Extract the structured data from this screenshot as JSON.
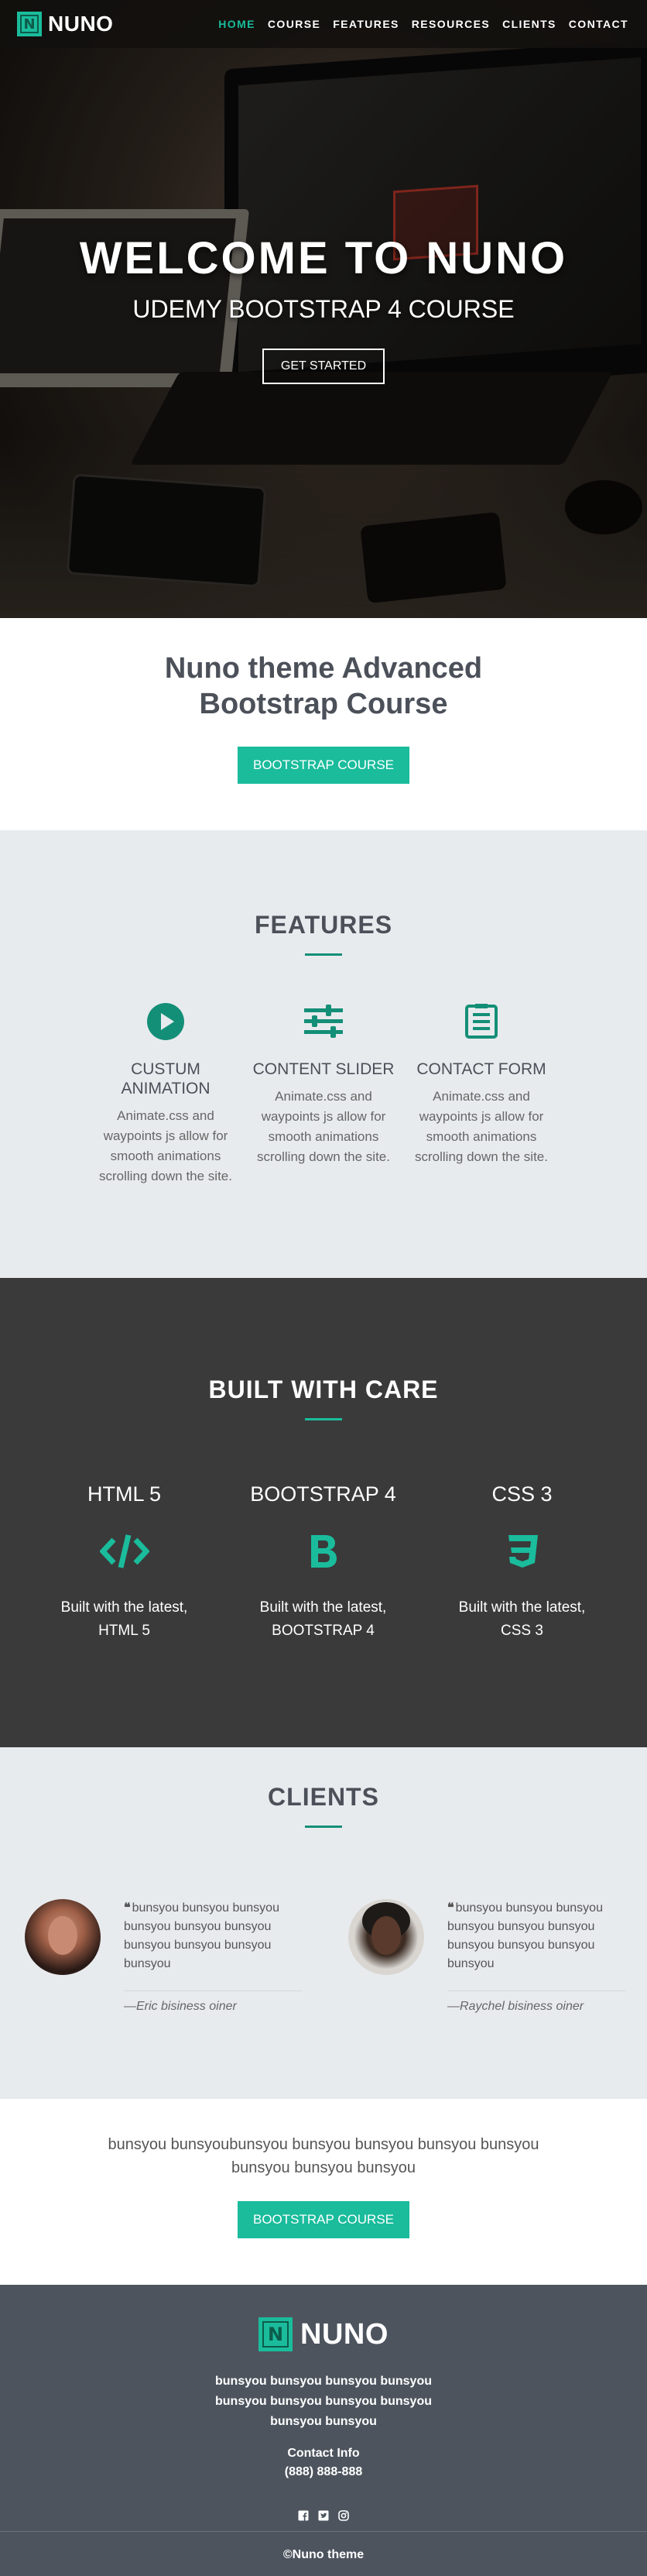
{
  "brand": {
    "name": "NUNO",
    "mark": "N"
  },
  "nav": {
    "items": [
      {
        "label": "HOME",
        "active": true
      },
      {
        "label": "COURSE"
      },
      {
        "label": "FEATURES"
      },
      {
        "label": "RESOURCES"
      },
      {
        "label": "CLIENTS"
      },
      {
        "label": "CONTACT"
      }
    ]
  },
  "hero": {
    "title": "WELCOME TO NUNO",
    "subtitle": "UDEMY BOOTSTRAP 4 COURSE",
    "button": "GET STARTED"
  },
  "intro": {
    "title": "Nuno theme Advanced Bootstrap Course",
    "button": "BOOTSTRAP COURSE"
  },
  "features": {
    "title": "FEATURES",
    "items": [
      {
        "icon": "play-circle-icon",
        "title": "CUSTUM ANIMATION",
        "text": "Animate.css and waypoints js allow for smooth animations scrolling down the site."
      },
      {
        "icon": "sliders-icon",
        "title": "CONTENT SLIDER",
        "text": "Animate.css and waypoints js allow for smooth animations scrolling down the site."
      },
      {
        "icon": "form-icon",
        "title": "CONTACT FORM",
        "text": "Animate.css and waypoints js allow for smooth animations scrolling down the site."
      }
    ]
  },
  "built": {
    "title": "BUILT WITH CARE",
    "items": [
      {
        "title": "HTML 5",
        "icon": "code-icon",
        "text": "Built with the latest, HTML 5"
      },
      {
        "title": "BOOTSTRAP 4",
        "icon": "bootstrap-icon",
        "text": "Built with the latest, BOOTSTRAP 4"
      },
      {
        "title": "CSS 3",
        "icon": "css3-icon",
        "text": "Built with the latest, CSS 3"
      }
    ]
  },
  "clients": {
    "title": "CLIENTS",
    "items": [
      {
        "quote": "bunsyou bunsyou bunsyou bunsyou bunsyou bunsyou bunsyou bunsyou bunsyou bunsyou",
        "author": "—Eric bisiness oiner"
      },
      {
        "quote": "bunsyou bunsyou bunsyou bunsyou bunsyou bunsyou bunsyou bunsyou bunsyou bunsyou",
        "author": "—Raychel bisiness oiner"
      }
    ]
  },
  "cta": {
    "text": "bunsyou bunsyoubunsyou bunsyou bunsyou bunsyou bunsyou bunsyou bunsyou bunsyou",
    "button": "BOOTSTRAP COURSE"
  },
  "footer": {
    "text": "bunsyou bunsyou bunsyou bunsyou bunsyou bunsyou bunsyou bunsyou bunsyou bunsyou",
    "info_label": "Contact Info",
    "phone": "(888) 888-888",
    "social": [
      "facebook-icon",
      "twitter-icon",
      "instagram-icon"
    ],
    "copyright": "©Nuno theme"
  },
  "colors": {
    "accent": "#1abc9c",
    "accent_dark": "#148f77",
    "dark": "#3a3a3a",
    "footer": "#4d545e",
    "light": "#e8ebee"
  }
}
